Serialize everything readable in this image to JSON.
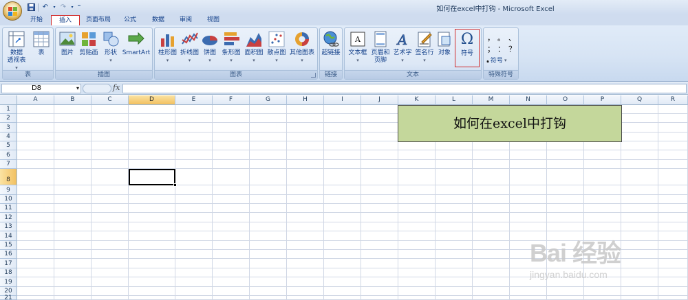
{
  "window": {
    "title": "如何在excel中打钩 - Microsoft Excel"
  },
  "tabs": [
    "开始",
    "插入",
    "页面布局",
    "公式",
    "数据",
    "审阅",
    "视图"
  ],
  "active_tab": "插入",
  "ribbon": {
    "table_group": {
      "label": "表",
      "pivot_line1": "数据",
      "pivot_line2": "透视表",
      "table": "表"
    },
    "illustrations_group": {
      "label": "插图",
      "picture": "图片",
      "clipart": "剪贴画",
      "shapes": "形状",
      "smartart": "SmartArt"
    },
    "charts_group": {
      "label": "图表",
      "column": "柱形图",
      "line": "折线图",
      "pie": "饼图",
      "bar": "条形图",
      "area": "面积图",
      "scatter": "散点图",
      "other": "其他图表"
    },
    "links_group": {
      "label": "链接",
      "hyperlink": "超链接"
    },
    "text_group": {
      "label": "文本",
      "textbox": "文本框",
      "header_line1": "页眉和",
      "header_line2": "页脚",
      "wordart": "艺术字",
      "signature": "签名行",
      "object": "对象",
      "symbol": "符号"
    },
    "special_group": {
      "label": "特殊符号",
      "sym1": "，",
      "sym2": "。",
      "sym3": "、",
      "sym4": "；",
      "sym5": "：",
      "sym6": "？",
      "more": "符号"
    }
  },
  "formula_bar": {
    "name_box": "D8",
    "fx": "fx",
    "content": ""
  },
  "sheet": {
    "columns": [
      "A",
      "B",
      "C",
      "D",
      "E",
      "F",
      "G",
      "H",
      "I",
      "J",
      "K",
      "L",
      "M",
      "N",
      "O",
      "P",
      "Q",
      "R"
    ],
    "rows": [
      "1",
      "2",
      "3",
      "4",
      "5",
      "6",
      "7",
      "8",
      "9",
      "10",
      "11",
      "12",
      "13",
      "14",
      "15",
      "16",
      "17",
      "18",
      "19",
      "20",
      "21"
    ],
    "active_cell": "D8",
    "note_text": "如何在excel中打钩"
  },
  "watermark": {
    "main": "Bai 经验",
    "sub": "jingyan.baidu.com"
  },
  "colors": {
    "note_fill": "#c4d79b",
    "highlight": "#d12a2a",
    "selected_header": "#f2c060"
  }
}
